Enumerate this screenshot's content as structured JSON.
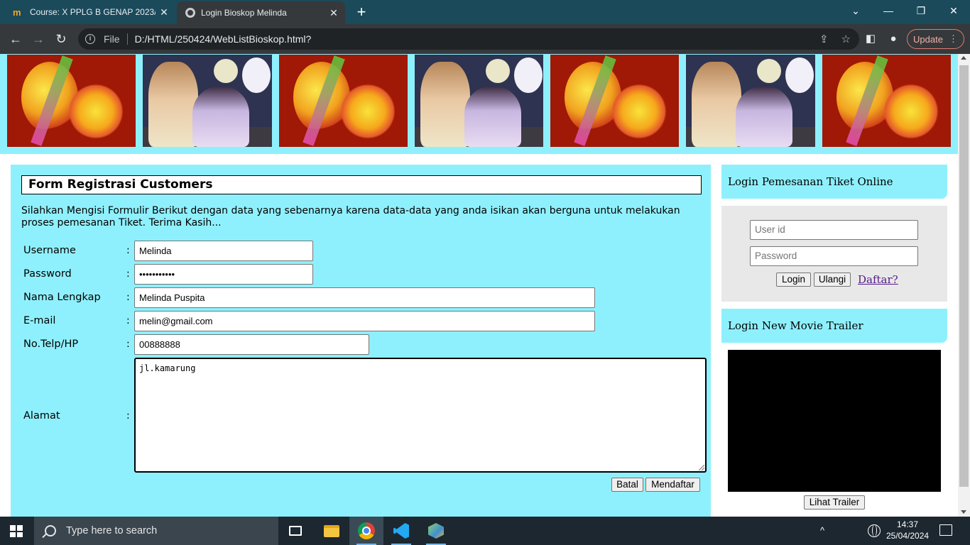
{
  "browser": {
    "tabs": [
      {
        "title": "Course: X PPLG B GENAP 2023/2024",
        "active": false,
        "favicon": "moodle-m-icon"
      },
      {
        "title": "Login Bioskop Melinda",
        "active": true,
        "favicon": "globe-icon"
      }
    ],
    "omnibox": {
      "scheme_label": "File",
      "url": "D:/HTML/250424/WebListBioskop.html?"
    },
    "update_label": "Update"
  },
  "banner": {
    "images": [
      "dragon",
      "anime",
      "dragon",
      "anime",
      "dragon",
      "anime",
      "dragon"
    ]
  },
  "form": {
    "title": "Form Registrasi Customers",
    "intro": "Silahkan Mengisi Formulir Berikut dengan data yang sebenarnya karena data-data yang anda isikan akan berguna untuk melakukan proses pemesanan Tiket. Terima Kasih...",
    "colon": ":",
    "fields": {
      "username": {
        "label": "Username",
        "value": "Melinda"
      },
      "password": {
        "label": "Password",
        "value": "•••••••••••"
      },
      "nama": {
        "label": "Nama Lengkap",
        "value": "Melinda Puspita"
      },
      "email": {
        "label": "E-mail",
        "value": "melin@gmail.com"
      },
      "telp": {
        "label": "No.Telp/HP",
        "value": "00888888"
      },
      "alamat": {
        "label": "Alamat",
        "value": "jl.kamarung"
      }
    },
    "buttons": {
      "batal": "Batal",
      "daftar": "Mendaftar"
    }
  },
  "login": {
    "header": "Login Pemesanan Tiket Online",
    "userid_placeholder": "User id",
    "password_placeholder": "Password",
    "login_btn": "Login",
    "reset_btn": "Ulangi",
    "register_link": "Daftar?"
  },
  "trailer": {
    "header": "Login New Movie Trailer",
    "button": "Lihat Trailer"
  },
  "taskbar": {
    "search_placeholder": "Type here to search",
    "time": "14:37",
    "date": "25/04/2024"
  },
  "colors": {
    "accent_cyan": "#8ff0fd",
    "tab_bar": "#1b4a5b",
    "toolbar": "#35393c"
  }
}
